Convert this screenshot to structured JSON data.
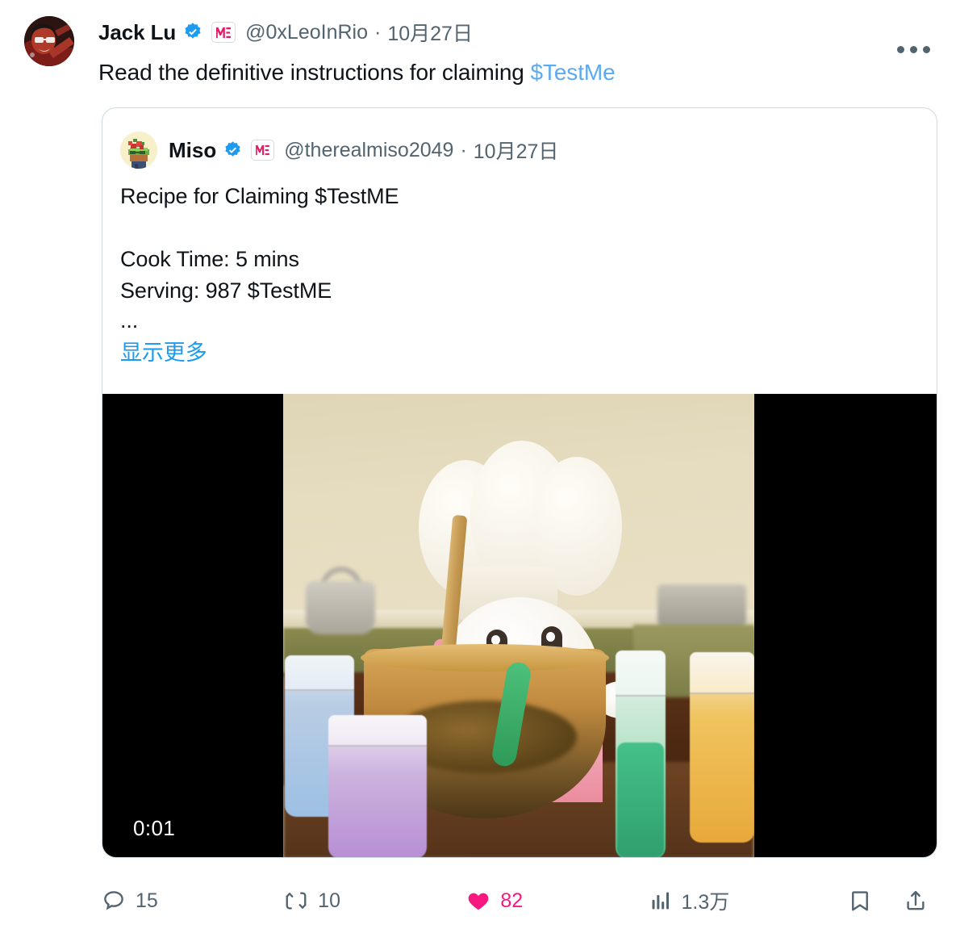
{
  "main_tweet": {
    "display_name": "Jack Lu",
    "handle": "@0xLeoInRio",
    "separator": "·",
    "date": "10月27日",
    "verified_icon": "verified-badge-icon",
    "affiliate_badge_icon": "me-affiliate-badge-icon",
    "more_icon": "more-options-icon",
    "text_before": "Read the definitive instructions for claiming ",
    "cashtag": "$TestMe"
  },
  "quoted_tweet": {
    "display_name": "Miso",
    "handle": "@therealmiso2049",
    "separator": "·",
    "date": "10月27日",
    "verified_icon": "verified-badge-icon",
    "affiliate_badge_icon": "me-affiliate-badge-icon",
    "line1": "Recipe for Claiming $TestME",
    "line2": "Cook Time: 5 mins",
    "line3": "Serving: 987 $TestME",
    "ellipsis": "...",
    "show_more": "显示更多",
    "media": {
      "type": "video",
      "timestamp": "0:01",
      "alt": "White chef character stirring a golden mixing bowl in a kitchen"
    }
  },
  "actions": [
    {
      "name": "reply",
      "icon": "reply-icon",
      "count": "15"
    },
    {
      "name": "retweet",
      "icon": "retweet-icon",
      "count": "10"
    },
    {
      "name": "like",
      "icon": "like-heart-icon",
      "count": "82"
    },
    {
      "name": "views",
      "icon": "views-chart-icon",
      "count": "1.3万"
    },
    {
      "name": "bookmark",
      "icon": "bookmark-icon",
      "count": ""
    },
    {
      "name": "share",
      "icon": "share-icon",
      "count": ""
    }
  ],
  "colors": {
    "text": "#0f1419",
    "secondary": "#536471",
    "link": "#1d9bf0",
    "cashtag": "#5daaf0",
    "like": "#f91880",
    "border": "#cfd9de",
    "verified": "#1d9bf0",
    "affiliate": "#e11d66",
    "background": "#ffffff"
  }
}
